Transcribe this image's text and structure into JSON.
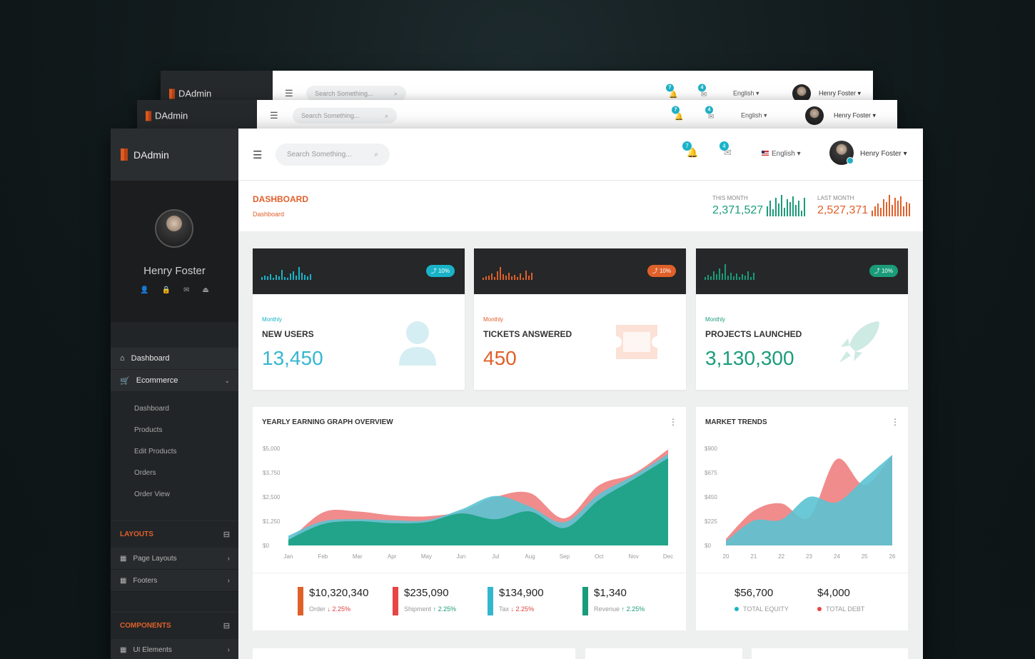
{
  "app": {
    "name": "DAdmin"
  },
  "topbar": {
    "search_placeholder": "Search Something...",
    "notif_count": "7",
    "mail_count": "4",
    "language": "English",
    "user": "Henry Foster"
  },
  "sidebar": {
    "profile_name": "Henry Foster",
    "nav": [
      {
        "label": "Dashboard",
        "icon": "home-icon"
      },
      {
        "label": "Ecommerce",
        "icon": "cart-icon"
      }
    ],
    "ecommerce_sub": [
      "Dashboard",
      "Products",
      "Edit Products",
      "Orders",
      "Order View"
    ],
    "layouts_title": "LAYOUTS",
    "layouts": [
      {
        "label": "Page Layouts"
      },
      {
        "label": "Footers"
      }
    ],
    "components_title": "COMPONENTS",
    "components": [
      {
        "label": "UI Elements"
      }
    ]
  },
  "header": {
    "title": "DASHBOARD",
    "crumb": "Dashboard",
    "this_month": {
      "label": "THIS MONTH",
      "value": "2,371,527",
      "color": "#1a9c7a"
    },
    "last_month": {
      "label": "LAST MONTH",
      "value": "2,527,371",
      "color": "#e0602a"
    }
  },
  "cards": [
    {
      "period": "Monthly",
      "title": "NEW USERS",
      "value": "13,450",
      "badge": "10%",
      "color": "#19b3c8",
      "icon": "user-icon"
    },
    {
      "period": "Monthly",
      "title": "TICKETS ANSWERED",
      "value": "450",
      "badge": "10%",
      "color": "#e0602a",
      "icon": "ticket-icon"
    },
    {
      "period": "Monthly",
      "title": "PROJECTS LAUNCHED",
      "value": "3,130,300",
      "badge": "10%",
      "color": "#1a9c7a",
      "icon": "rocket-icon"
    }
  ],
  "yearly": {
    "title": "YEARLY EARNING GRAPH OVERVIEW",
    "legend": [
      {
        "value": "$10,320,340",
        "label": "Order",
        "change": "2.25%",
        "dir": "down",
        "color": "#e0602a"
      },
      {
        "value": "$235,090",
        "label": "Shipment",
        "change": "2.25%",
        "dir": "up",
        "color": "#e84545"
      },
      {
        "value": "$134,900",
        "label": "Tax",
        "change": "2.25%",
        "dir": "down",
        "color": "#35b6cf"
      },
      {
        "value": "$1,340",
        "label": "Revenue",
        "change": "2.25%",
        "dir": "up",
        "color": "#1a9c7a"
      }
    ]
  },
  "market": {
    "title": "MARKET TRENDS",
    "legend": [
      {
        "value": "$56,700",
        "label": "TOTAL EQUITY",
        "color": "#19b3c8"
      },
      {
        "value": "$4,000",
        "label": "TOTAL DEBT",
        "color": "#e84545"
      }
    ]
  },
  "chart_data": [
    {
      "type": "area",
      "title": "YEARLY EARNING GRAPH OVERVIEW",
      "categories": [
        "Jan",
        "Feb",
        "Mar",
        "Apr",
        "May",
        "Jun",
        "Jul",
        "Aug",
        "Sep",
        "Oct",
        "Nov",
        "Dec"
      ],
      "yticks": [
        "$0",
        "$1,250",
        "$2,500",
        "$3,750",
        "$5,000"
      ],
      "ylim": [
        0,
        5000
      ],
      "series": [
        {
          "color": "#f08080",
          "values": [
            200,
            1700,
            1750,
            1550,
            1500,
            1750,
            2500,
            2700,
            1400,
            3100,
            3700,
            4950
          ]
        },
        {
          "color": "#5bc2d2",
          "values": [
            500,
            1250,
            1350,
            1300,
            1300,
            1850,
            2550,
            2000,
            1200,
            2650,
            3600,
            4700
          ]
        },
        {
          "color": "#1aa182",
          "values": [
            300,
            1100,
            1250,
            1150,
            1200,
            1650,
            1350,
            1750,
            900,
            2350,
            3400,
            4500
          ]
        }
      ]
    },
    {
      "type": "area",
      "title": "MARKET TRENDS",
      "categories": [
        "20",
        "21",
        "22",
        "23",
        "24",
        "25",
        "26"
      ],
      "yticks": [
        "$0",
        "$225",
        "$450",
        "$675",
        "$900"
      ],
      "ylim": [
        0,
        900
      ],
      "series": [
        {
          "color": "#f08080",
          "values": [
            60,
            320,
            390,
            260,
            800,
            560,
            840
          ]
        },
        {
          "color": "#5bc2d2",
          "values": [
            40,
            230,
            240,
            450,
            400,
            620,
            840
          ]
        }
      ]
    }
  ]
}
